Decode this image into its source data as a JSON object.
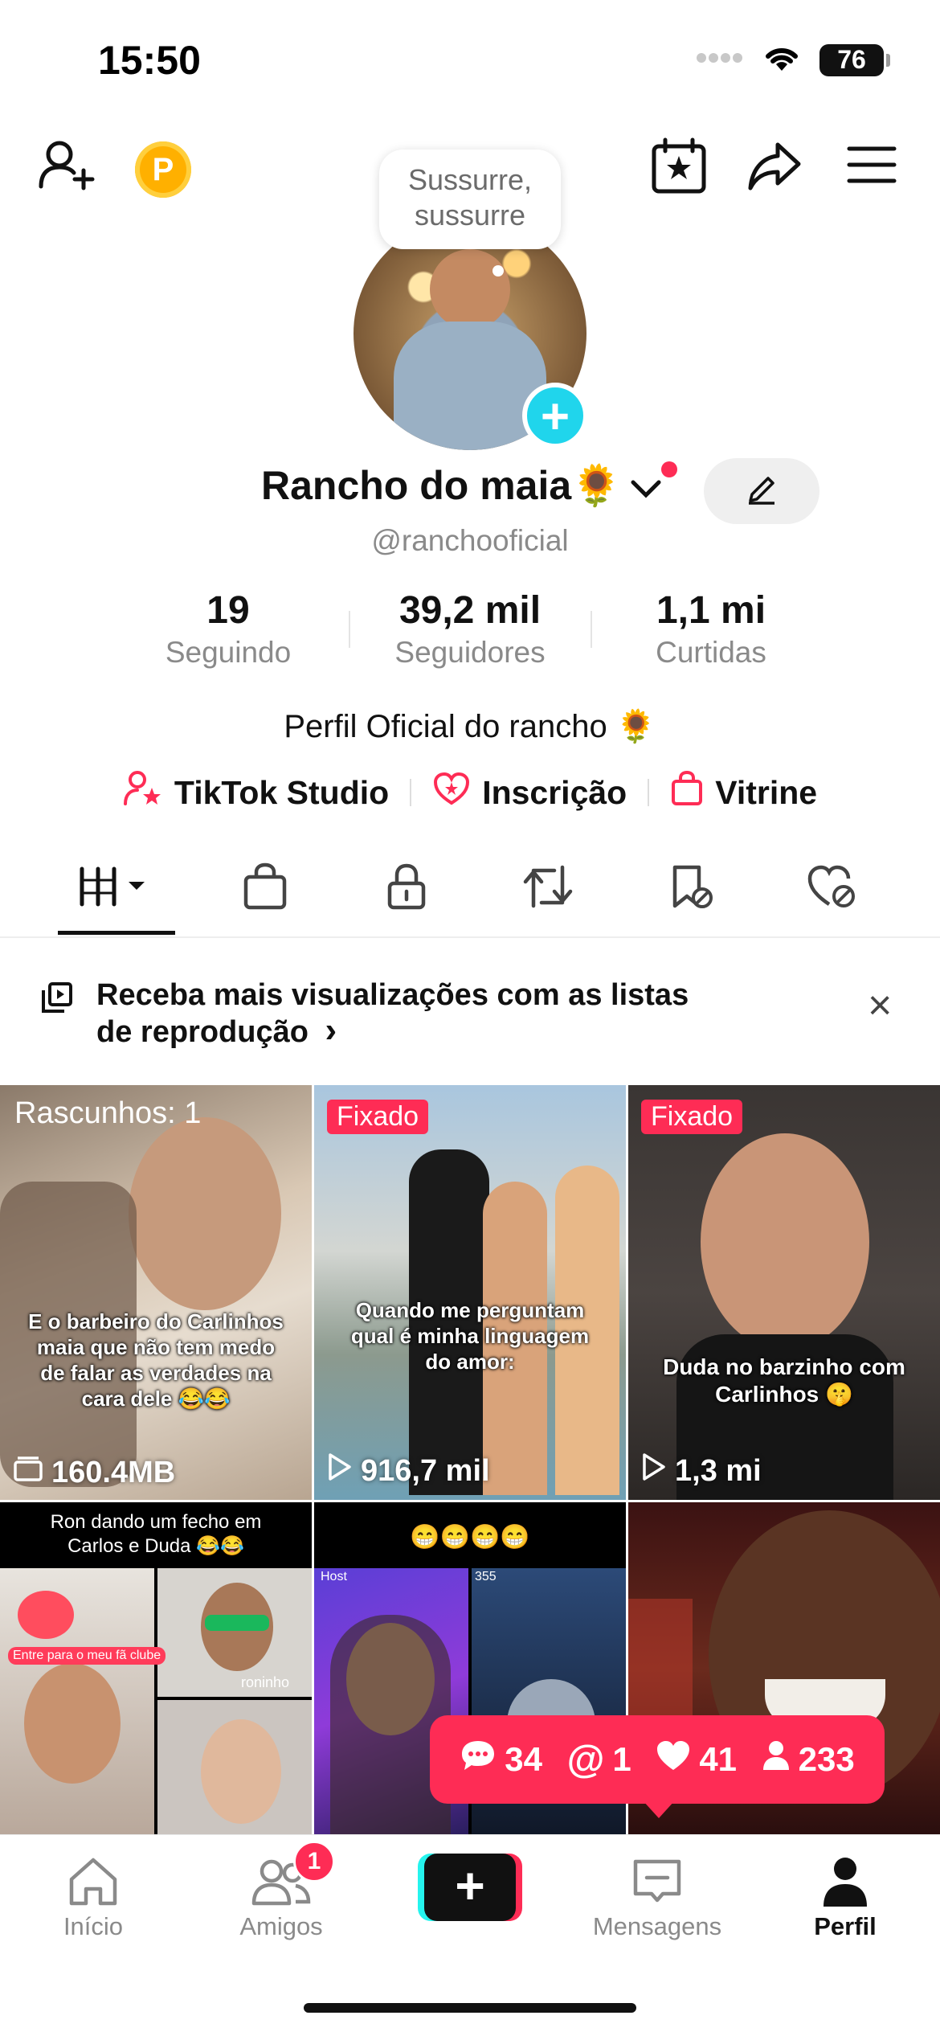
{
  "status_bar": {
    "time": "15:50",
    "battery": "76"
  },
  "profile": {
    "note_bubble": "Sussurre, sussurre",
    "name": "Rancho do maia🌻",
    "handle": "@ranchooficial",
    "stats": [
      {
        "value": "19",
        "label": "Seguindo"
      },
      {
        "value": "39,2 mil",
        "label": "Seguidores"
      },
      {
        "value": "1,1 mi",
        "label": "Curtidas"
      }
    ],
    "bio": "Perfil Oficial do rancho 🌻",
    "links": [
      {
        "label": "TikTok Studio",
        "icon": "person-star-icon"
      },
      {
        "label": "Inscrição",
        "icon": "heart-star-icon"
      },
      {
        "label": "Vitrine",
        "icon": "shopping-bag-icon"
      }
    ]
  },
  "tabs": [
    "videos-grid-icon",
    "shopping-bag-icon",
    "lock-icon",
    "repost-icon",
    "favorites-hidden-icon",
    "liked-hidden-icon"
  ],
  "banner": {
    "text": "Receba mais visualizações com as listas de reprodução",
    "chevron": "›",
    "close": "×"
  },
  "grid": [
    {
      "badge": "Rascunhos: 1",
      "caption": "E o barbeiro do Carlinhos maia que não tem medo de falar as verdades na cara dele 😂😂",
      "count": "160.4MB",
      "count_icon": "drafts-icon"
    },
    {
      "pin": "Fixado",
      "caption": "Quando me perguntam qual é minha linguagem do amor:",
      "count": "916,7 mil",
      "count_icon": "play-icon"
    },
    {
      "pin": "Fixado",
      "caption": "Duda no barzinho com Carlinhos 🤫",
      "count": "1,3 mi",
      "count_icon": "play-icon"
    },
    {
      "caption": "Ron dando um fecho em Carlos e Duda 😂😂",
      "inner_text": "roninho",
      "overlay_text": "Entre para o meu fã clube"
    },
    {
      "caption": "😁😁😁😁",
      "inner_text": "Host",
      "inner_count": "355"
    },
    {
      "caption": ""
    }
  ],
  "notification": {
    "comments": "34",
    "mentions": "1",
    "likes": "41",
    "followers": "233"
  },
  "bottom_nav": [
    {
      "label": "Início",
      "icon": "home-icon"
    },
    {
      "label": "Amigos",
      "icon": "friends-icon",
      "badge": "1"
    },
    {
      "label": "",
      "icon": "plus-icon"
    },
    {
      "label": "Mensagens",
      "icon": "messages-icon"
    },
    {
      "label": "Perfil",
      "icon": "profile-icon"
    }
  ],
  "colors": {
    "accent": "#fe2c55",
    "cyan": "#20d5ec",
    "muted": "#8a8a8a"
  }
}
